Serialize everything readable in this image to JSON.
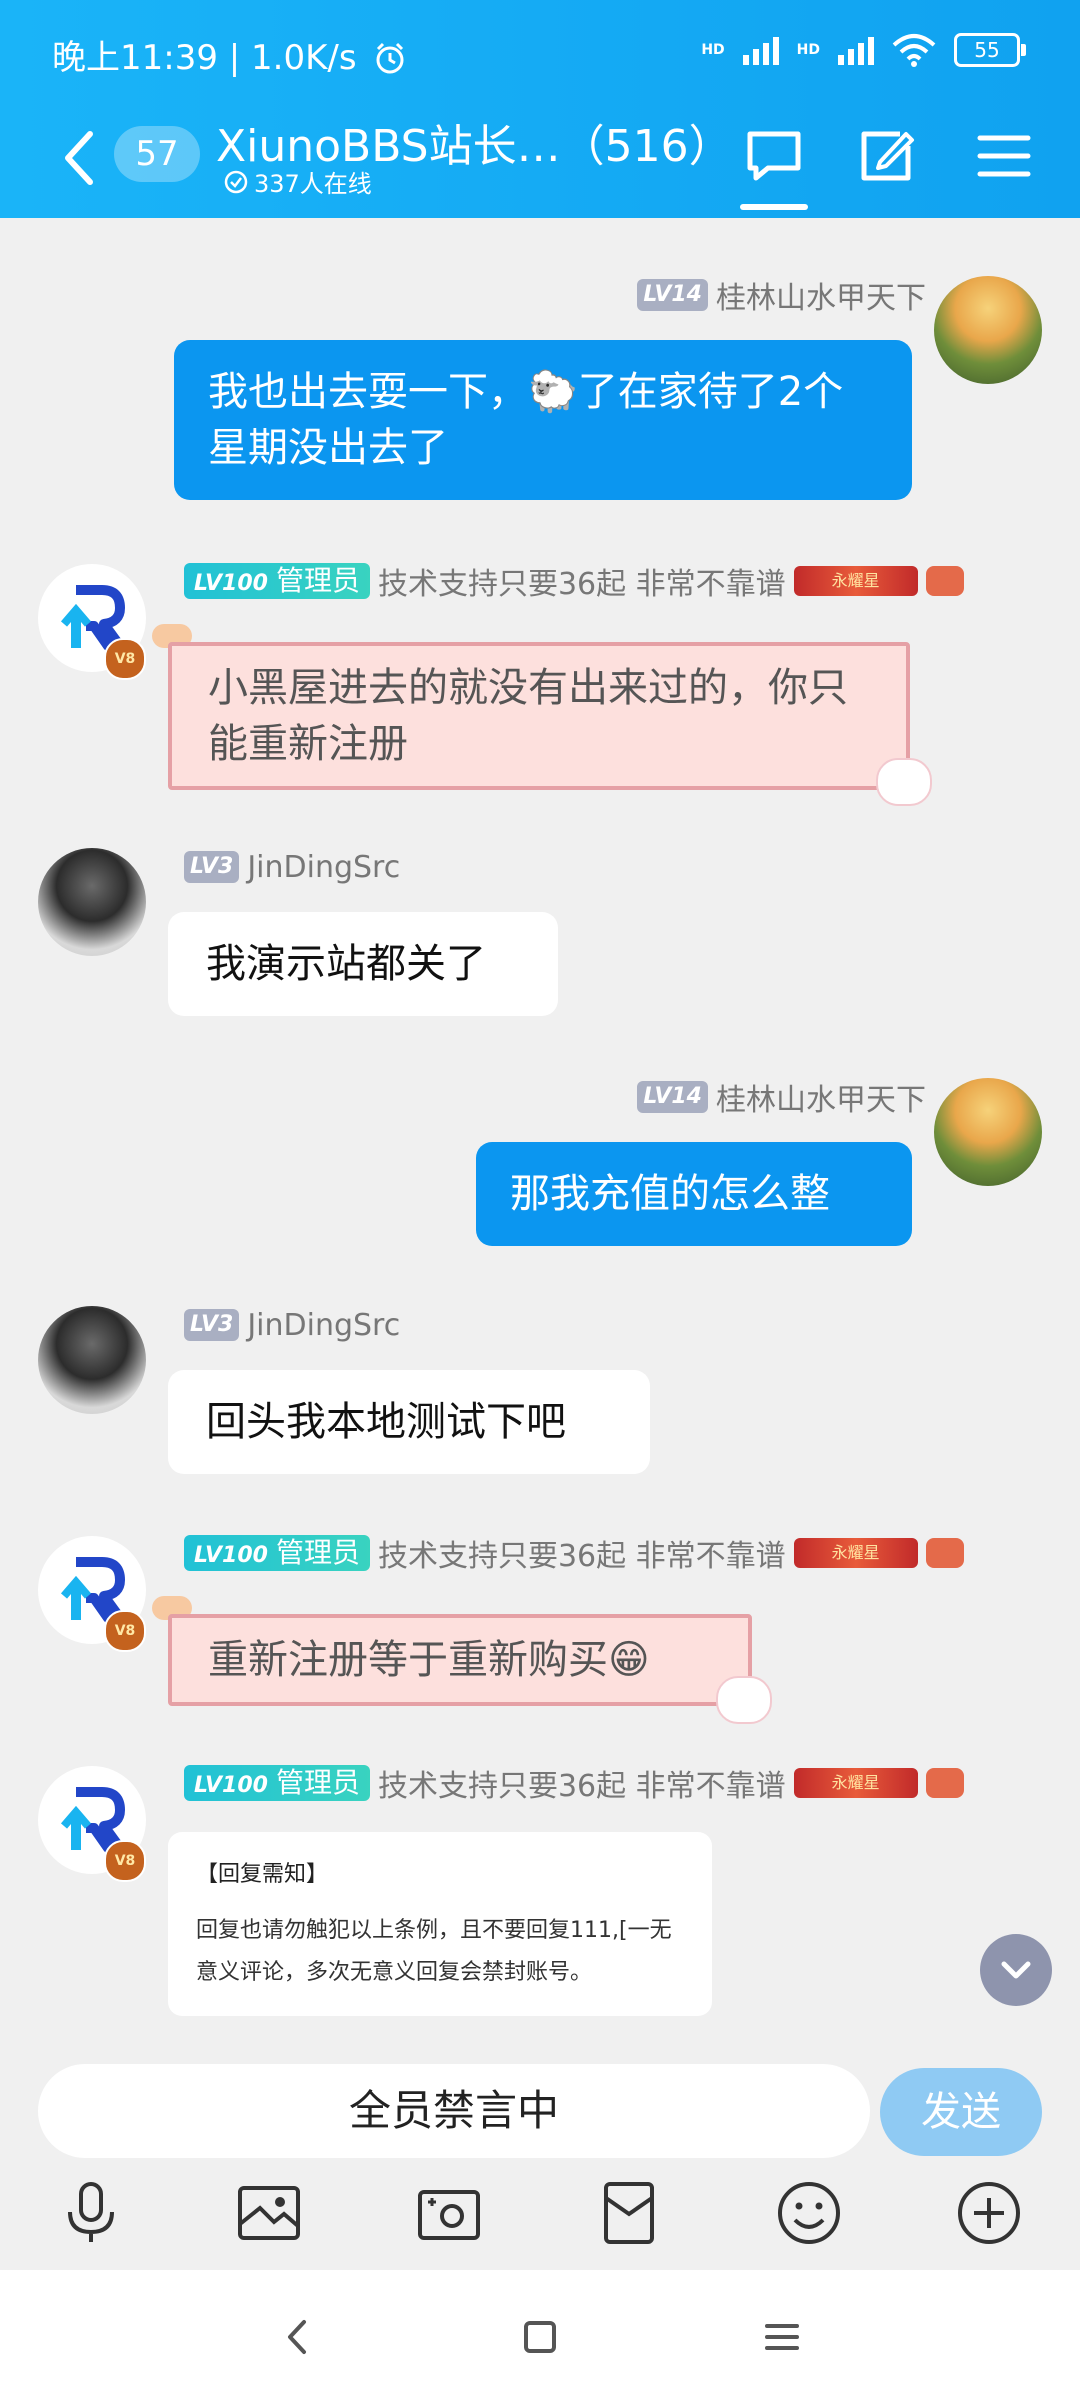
{
  "status_bar": {
    "time_text": "晚上11:39 | 1.0K/s",
    "battery": "55",
    "signal_label": "HD"
  },
  "nav": {
    "unread_count": "57",
    "title": "XiunoBBS站长…（516）",
    "online_text": "337人在线"
  },
  "messages": [
    {
      "level": "LV14",
      "name": "桂林山水甲天下",
      "text": "我也出去耍一下，🐑了在家待了2个星期没出去了"
    },
    {
      "level": "LV100",
      "role": "管理员",
      "name": "技术支持只要36起 非常不靠谱",
      "medal": "永耀星",
      "vip": "V8",
      "text": "小黑屋进去的就没有出来过的，你只能重新注册"
    },
    {
      "level": "LV3",
      "name": "JinDingSrc",
      "text": "我演示站都关了"
    },
    {
      "level": "LV14",
      "name": "桂林山水甲天下",
      "text": "那我充值的怎么整"
    },
    {
      "level": "LV3",
      "name": "JinDingSrc",
      "text": "回头我本地测试下吧"
    },
    {
      "level": "LV100",
      "role": "管理员",
      "name": "技术支持只要36起 非常不靠谱",
      "medal": "永耀星",
      "vip": "V8",
      "text": "重新注册等于重新购买😁"
    },
    {
      "level": "LV100",
      "role": "管理员",
      "name": "技术支持只要36起 非常不靠谱",
      "medal": "永耀星",
      "vip": "V8",
      "card_title": "【回复需知】",
      "card_text": "回复也请勿触犯以上条例，且不要回复111,[一无意义评论，多次无意义回复会禁封账号。"
    }
  ],
  "input": {
    "text": "全员禁言中",
    "send_label": "发送"
  },
  "toolbar": [
    "mic-icon",
    "image-icon",
    "camera-icon",
    "red-packet-icon",
    "emoji-icon",
    "plus-icon"
  ],
  "colors": {
    "header": "#1ab4f8",
    "self_bubble": "#0b96f0",
    "admin_bubble_bg": "#fde0dd",
    "send_button": "#8fcaf3"
  }
}
